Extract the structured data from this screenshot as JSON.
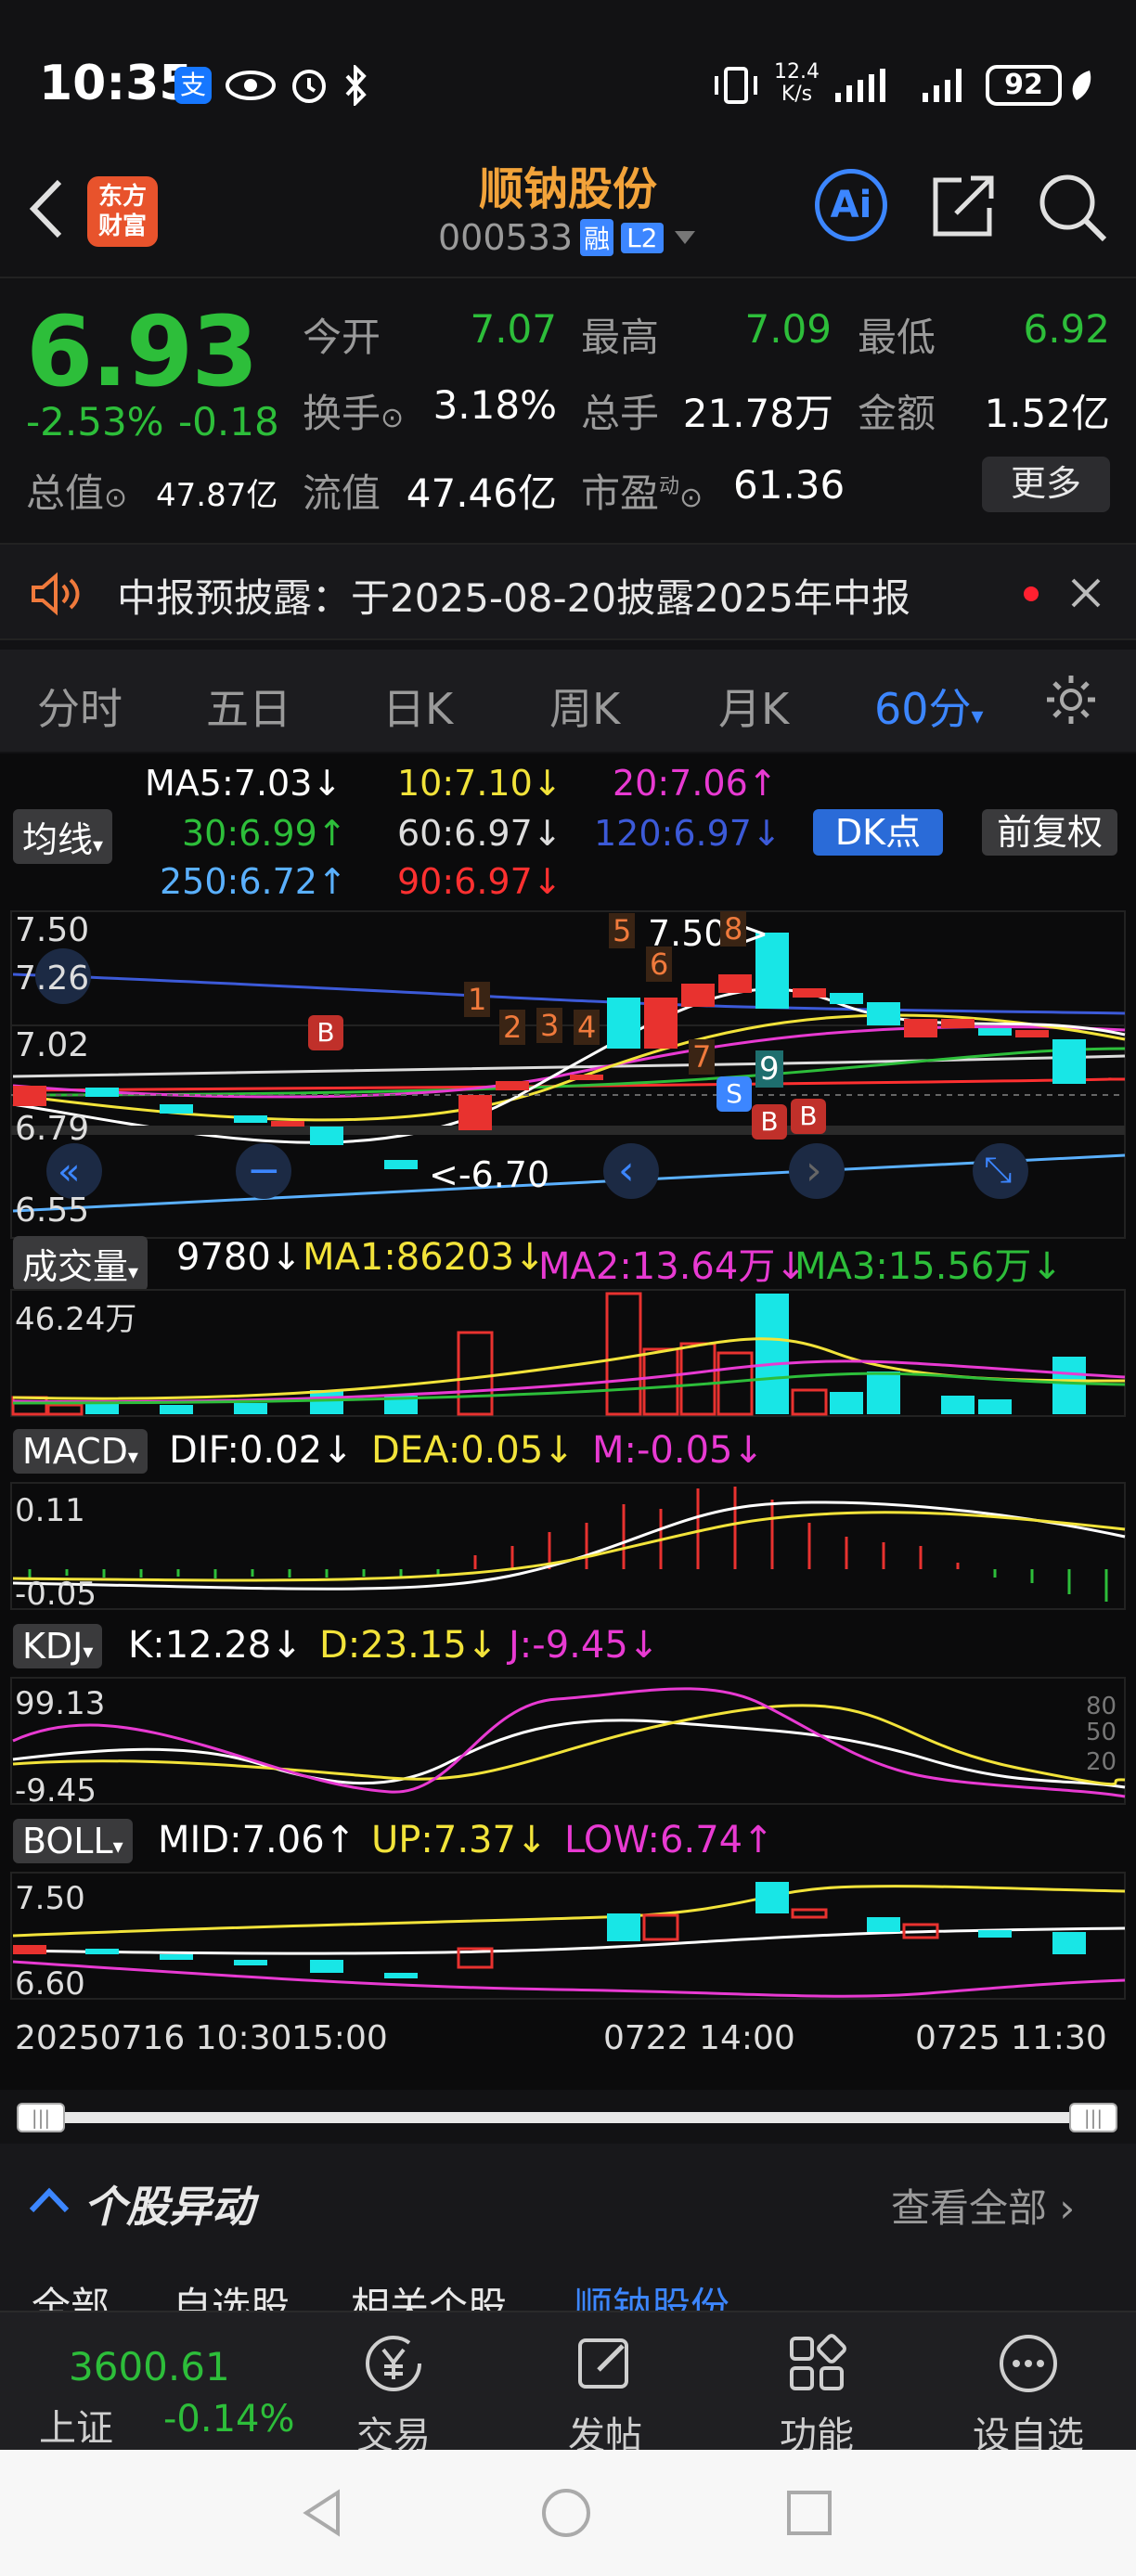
{
  "status_bar": {
    "time": "10:35",
    "net_speed_value": "12.4",
    "net_speed_unit": "K/s",
    "battery": "92"
  },
  "header": {
    "back_icon": "back-arrow-icon",
    "logo_line1": "东方",
    "logo_line2": "财富",
    "title": "顺钠股份",
    "code": "000533",
    "badge_rong": "融",
    "badge_level": "L2",
    "ai_label": "Ai"
  },
  "quote": {
    "price": "6.93",
    "change_pct": "-2.53%",
    "change": "-0.18",
    "open_label": "今开",
    "open": "7.07",
    "high_label": "最高",
    "high": "7.09",
    "low_label": "最低",
    "low": "6.92",
    "turnover_label": "换手",
    "turnover": "3.18%",
    "volume_label": "总手",
    "volume": "21.78万",
    "amount_label": "金额",
    "amount": "1.52亿",
    "total_cap_label": "总值",
    "total_cap": "47.87亿",
    "float_cap_label": "流值",
    "float_cap": "47.46亿",
    "pe_label": "市盈",
    "pe_sup": "动",
    "pe": "61.36",
    "more_label": "更多"
  },
  "notice": {
    "text": "中报预披露：于2025-08-20披露2025年中报"
  },
  "tabs": [
    {
      "label": "分时",
      "active": false
    },
    {
      "label": "五日",
      "active": false
    },
    {
      "label": "日K",
      "active": false
    },
    {
      "label": "周K",
      "active": false
    },
    {
      "label": "月K",
      "active": false
    },
    {
      "label": "60分",
      "active": true
    }
  ],
  "chart": {
    "ma_selector": "均线",
    "ma5": "MA5:7.03↓",
    "ma10": "10:7.10↓",
    "ma20": "20:7.06↑",
    "ma30": "30:6.99↑",
    "ma60": "60:6.97↓",
    "ma120": "120:6.97↓",
    "ma250": "250:6.72↑",
    "ma90": "90:6.97↓",
    "dk_button": "DK点",
    "adjust_button": "前复权",
    "price_ticks": [
      "7.50",
      "7.26",
      "7.02",
      "6.79",
      "6.55"
    ],
    "high_marker": "7.50->",
    "low_marker": "<-6.70",
    "nine_digits": [
      "1",
      "2",
      "3",
      "4",
      "5",
      "6",
      "7",
      "8",
      "9"
    ],
    "vol_selector": "成交量",
    "vol_value": "9780↓",
    "vol_ma1": "MA1:86203↓",
    "vol_ma2": "MA2:13.64万↓",
    "vol_ma3": "MA3:15.56万↓",
    "vol_tick": "46.24万",
    "macd_selector": "MACD",
    "macd_dif": "DIF:0.02↓",
    "macd_dea": "DEA:0.05↓",
    "macd_m": "M:-0.05↓",
    "macd_ticks": [
      "0.11",
      "-0.05"
    ],
    "kdj_selector": "KDJ",
    "kdj_k": "K:12.28↓",
    "kdj_d": "D:23.15↓",
    "kdj_j": "J:-9.45↓",
    "kdj_ticks": [
      "99.13",
      "-9.45"
    ],
    "kdj_right_ticks": [
      "80",
      "50",
      "20"
    ],
    "boll_selector": "BOLL",
    "boll_mid": "MID:7.06↑",
    "boll_up": "UP:7.37↓",
    "boll_low": "LOW:6.74↑",
    "boll_ticks": [
      "7.50",
      "6.60"
    ],
    "time_labels": [
      "20250716 10:30",
      "15:00",
      "0722 14:00",
      "0725 11:30"
    ]
  },
  "movers": {
    "title": "个股异动",
    "view_all": "查看全部"
  },
  "subtabs": [
    "全部",
    "自选股",
    "相关个股",
    "顺钠股份"
  ],
  "bottom_bar": {
    "index_value": "3600.61",
    "index_name": "上证",
    "index_change": "-0.14%",
    "items": [
      {
        "label": "交易",
        "icon": "trade-yen-icon"
      },
      {
        "label": "发帖",
        "icon": "post-edit-icon"
      },
      {
        "label": "功能",
        "icon": "function-grid-icon"
      },
      {
        "label": "设自选",
        "icon": "more-dots-icon"
      }
    ]
  },
  "colors": {
    "up": "#e8322f",
    "down": "#18e6e6",
    "green": "#2dbe3a",
    "accent": "#f2a33a",
    "blue": "#3c86ff"
  }
}
